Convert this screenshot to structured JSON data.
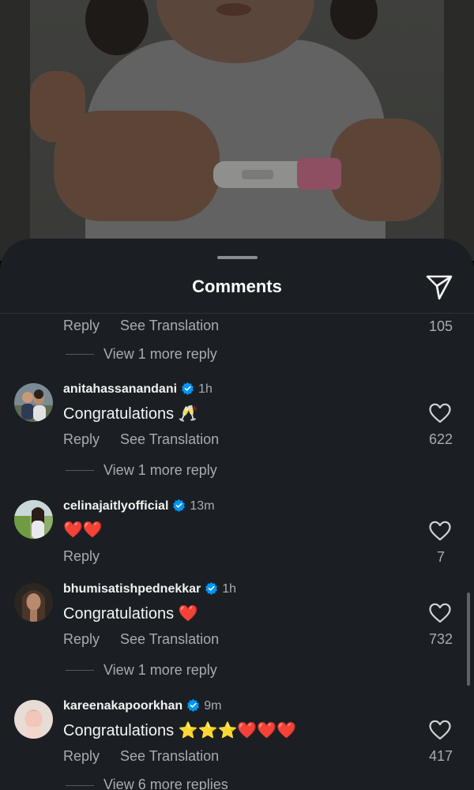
{
  "sheet": {
    "title": "Comments",
    "share_icon": "send-icon"
  },
  "top_row": {
    "reply_label": "Reply",
    "translate_label": "See Translation",
    "likes": "105",
    "more_replies": "View 1 more reply"
  },
  "comments": [
    {
      "username": "anitahassanandani",
      "verified": true,
      "time": "1h",
      "text": "Congratulations 🥂",
      "reply_label": "Reply",
      "translate_label": "See Translation",
      "likes": "622",
      "more_replies": "View 1 more reply"
    },
    {
      "username": "celinajaitlyofficial",
      "verified": true,
      "time": "13m",
      "text": "❤️❤️",
      "reply_label": "Reply",
      "likes": "7"
    },
    {
      "username": "bhumisatishpednekkar",
      "verified": true,
      "time": "1h",
      "text": "Congratulations ❤️",
      "reply_label": "Reply",
      "translate_label": "See Translation",
      "likes": "732",
      "more_replies": "View 1 more reply"
    },
    {
      "username": "kareenakapoorkhan",
      "verified": true,
      "time": "9m",
      "text": "Congratulations ⭐⭐⭐❤️❤️❤️",
      "reply_label": "Reply",
      "translate_label": "See Translation",
      "likes": "417",
      "more_replies": "View 6 more replies"
    }
  ],
  "colors": {
    "sheet_bg": "#1b1f23",
    "verified_blue": "#0095f6",
    "secondary_text": "#a8acb0"
  }
}
